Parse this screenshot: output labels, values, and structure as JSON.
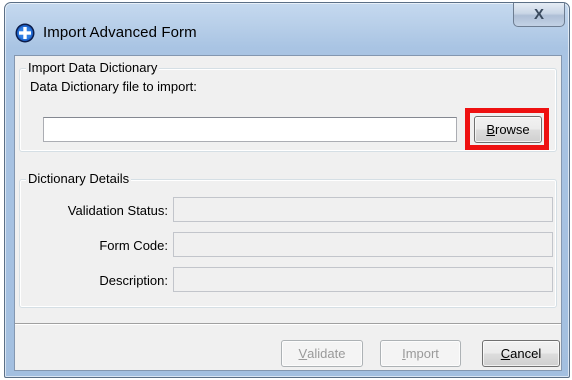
{
  "window": {
    "title": "Import Advanced Form",
    "close_glyph": "X",
    "app_icon": "blue-circle-plus-icon"
  },
  "import_group": {
    "legend": "Import Data Dictionary",
    "file_label": "Data Dictionary file to import:",
    "file_value": "",
    "browse": {
      "first": "B",
      "rest": "rowse"
    }
  },
  "details_group": {
    "legend": "Dictionary Details",
    "validation_status_label": "Validation Status:",
    "validation_status_value": "",
    "form_code_label": "Form Code:",
    "form_code_value": "",
    "description_label": "Description:",
    "description_value": ""
  },
  "buttons": {
    "validate": {
      "first": "V",
      "rest": "alidate",
      "enabled": false
    },
    "import": {
      "first": "I",
      "rest": "mport",
      "enabled": false
    },
    "cancel": {
      "first": "C",
      "rest": "ancel",
      "enabled": true
    }
  },
  "colors": {
    "highlight": "#ee1111",
    "title_bar": "#a9c4e3",
    "dialog_bg": "#f0f0f0"
  }
}
